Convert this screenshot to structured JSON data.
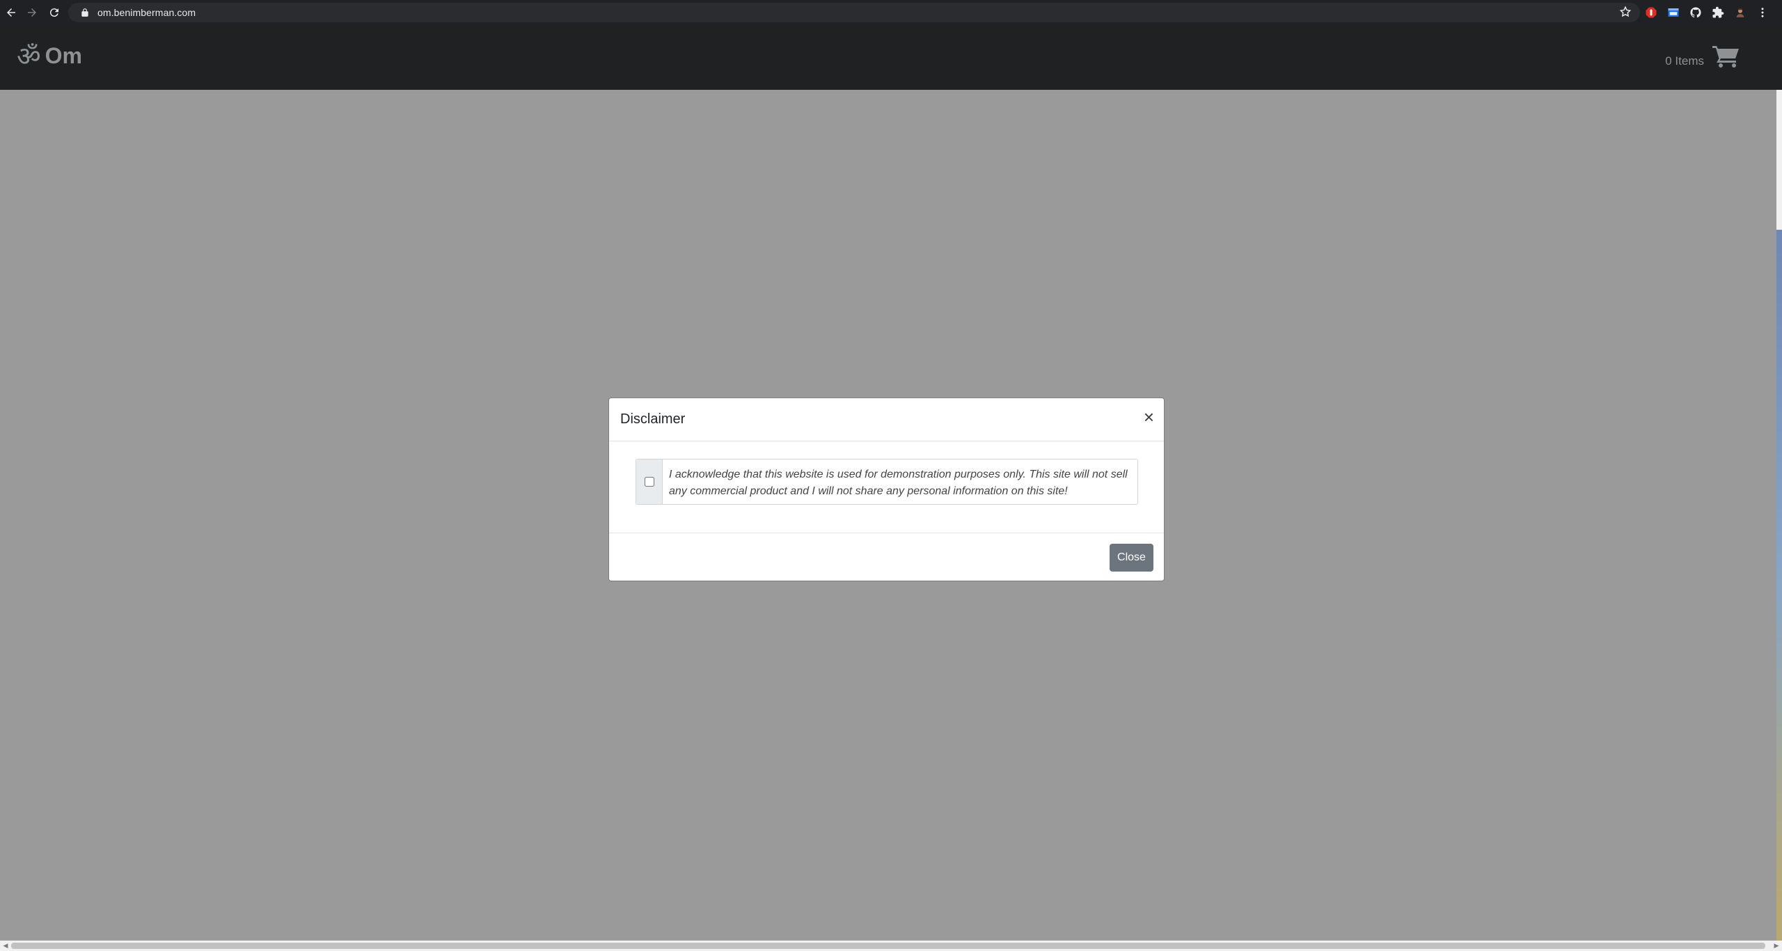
{
  "browser": {
    "url": "om.benimberman.com",
    "icons": {
      "back": "back-arrow-icon",
      "forward": "forward-arrow-icon",
      "reload": "reload-icon",
      "lock": "lock-icon",
      "bookmark": "star-icon",
      "extensions": [
        "adblock-icon",
        "window-extension-icon",
        "github-icon",
        "puzzle-extensions-icon",
        "profile-avatar-icon",
        "menu-dots-icon"
      ]
    }
  },
  "site": {
    "brand_symbol": "ॐ",
    "brand_name": "Om",
    "cart_count": "0 Items",
    "colors": {
      "navbar_bg": "#1f2123",
      "brand_text": "#8f9294",
      "overlay": "#9a9a9a"
    }
  },
  "modal": {
    "title": "Disclaimer",
    "close_symbol": "×",
    "acknowledgement": "I acknowledge that this website is used for demonstration purposes only. This site will not sell any commercial product and I will not share any personal information on this site!",
    "checkbox_checked": false,
    "close_button": "Close",
    "colors": {
      "button_bg": "#6c757d",
      "addon_bg": "#e9ecef"
    }
  }
}
